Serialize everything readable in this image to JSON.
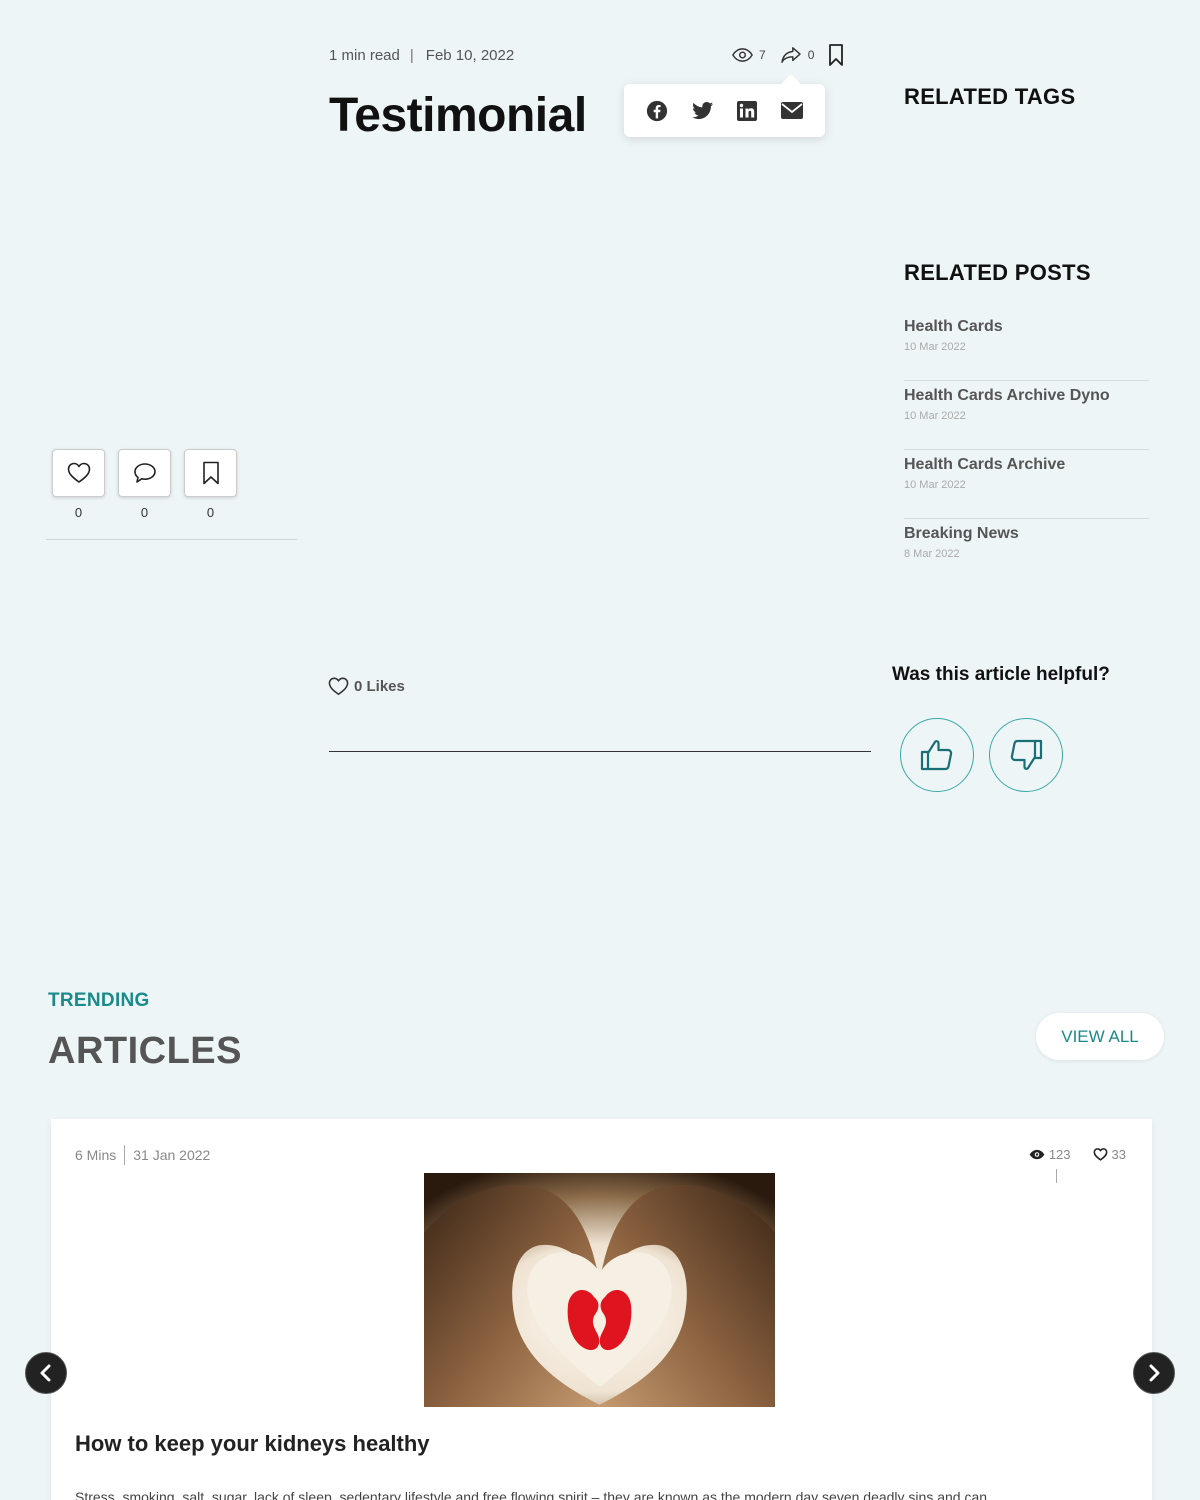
{
  "article": {
    "read_time": "1 min read",
    "separator": "|",
    "date": "Feb 10, 2022",
    "title": "Testimonial",
    "views": "7",
    "shares": "0",
    "likes_label": "0 Likes"
  },
  "share_menu": {
    "icons": [
      "facebook-icon",
      "twitter-icon",
      "linkedin-icon",
      "email-icon"
    ]
  },
  "actions": {
    "like_count": "0",
    "comment_count": "0",
    "bookmark_count": "0"
  },
  "sidebar": {
    "tags_heading": "RELATED TAGS",
    "posts_heading": "RELATED POSTS",
    "posts": [
      {
        "title": "Health Cards",
        "date": "10 Mar 2022"
      },
      {
        "title": "Health Cards Archive Dyno",
        "date": "10 Mar 2022"
      },
      {
        "title": "Health Cards Archive",
        "date": "10 Mar 2022"
      },
      {
        "title": "Breaking News",
        "date": "8 Mar 2022"
      }
    ]
  },
  "feedback": {
    "question": "Was this article helpful?"
  },
  "trending": {
    "label": "TRENDING",
    "title": "ARTICLES",
    "view_all": "VIEW ALL",
    "card": {
      "read_time": "6 Mins",
      "date": "31 Jan 2022",
      "views": "123",
      "likes": "33",
      "title": "How to keep your kidneys healthy",
      "excerpt": "Stress, smoking, salt, sugar, lack of sleep, sedentary lifestyle and free flowing spirit – they are known as the modern day seven deadly sins and can"
    }
  },
  "colors": {
    "background": "#eef5f7",
    "accent": "#1a8a8a",
    "kidney_red": "#e0141e"
  }
}
